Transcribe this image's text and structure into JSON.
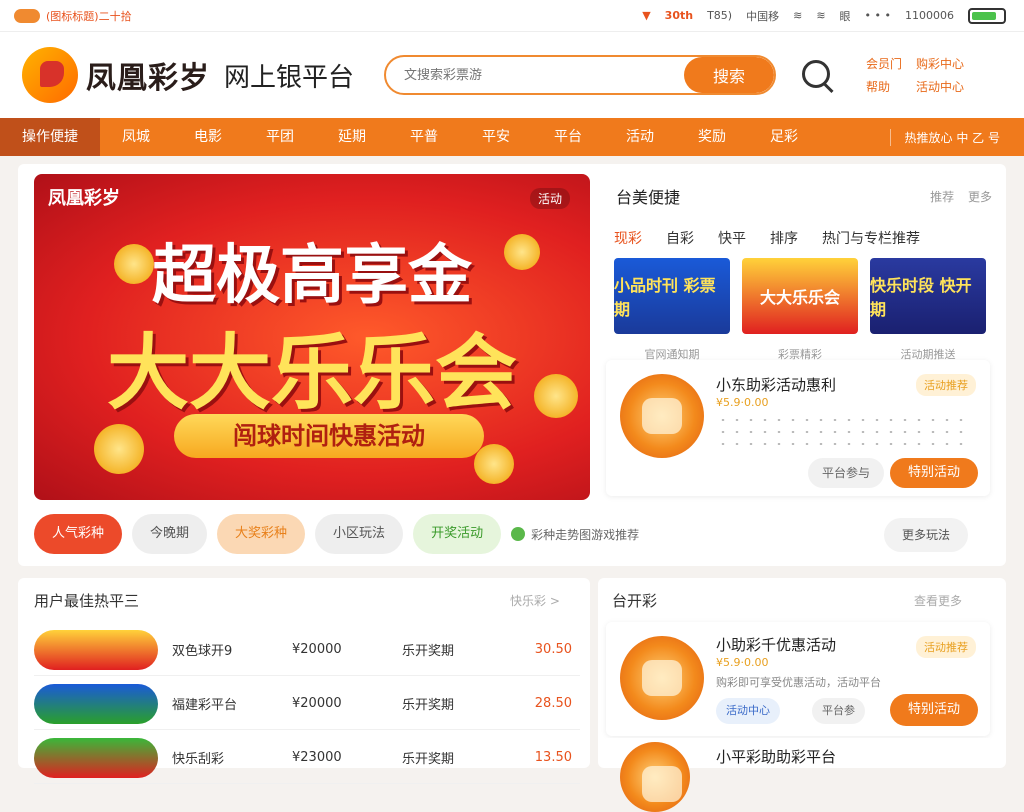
{
  "topstrip": {
    "left_text": "(图标标题)二十拾",
    "signal": "30th",
    "time_label": "T85)",
    "carrier": "中国移",
    "status": "眼",
    "dots": "• • •",
    "battery": "1100006"
  },
  "header": {
    "brand": "凤凰彩岁",
    "platform": "网上银平台",
    "search_placeholder": "文搜索彩票游",
    "search_button": "搜索",
    "links": [
      "会员门",
      "购彩中心",
      "帮助",
      "活动中心"
    ]
  },
  "nav": {
    "items": [
      "操作便捷",
      "凤城",
      "电影",
      "平团",
      "延期",
      "平普",
      "平安",
      "平台",
      "活动",
      "奖励",
      "足彩"
    ],
    "more": "热推放心 中 乙 号"
  },
  "banner": {
    "logo": "凤凰彩岁",
    "tag": "活动",
    "headline1": "超极高享金",
    "headline2": "大大乐乐会",
    "ribbon": "闯球时间快惠活动"
  },
  "right_panel": {
    "title": "台美便捷",
    "links": [
      "推荐",
      "更多"
    ],
    "tabs": [
      "现彩",
      "自彩",
      "快平",
      "排序",
      "热门与专栏推荐"
    ],
    "thumbs": [
      {
        "text": "小品时刊 彩票期"
      },
      {
        "text": "大大乐乐会"
      },
      {
        "text": "快乐时段 快开期"
      }
    ],
    "thumb_captions": [
      "官网通知期",
      "彩票精彩",
      "活动期推送"
    ]
  },
  "promo1": {
    "title": "小东助彩活动惠利",
    "sub": "¥5.9·0.00",
    "tag": "活动推荐",
    "btn_small": "平台参与",
    "btn_main": "特别活动"
  },
  "chips": [
    "人气彩种",
    "今晚期",
    "大奖彩种",
    "小区玩法",
    "开奖活动",
    "彩种走势图游戏推荐",
    "更多玩法"
  ],
  "list": {
    "title": "用户最佳热平三",
    "more": "快乐彩 >",
    "rows": [
      {
        "name": "双色球开9",
        "amount": "¥20000",
        "play": "乐开奖期",
        "price": "30.50"
      },
      {
        "name": "福建彩平台",
        "amount": "¥20000",
        "play": "乐开奖期",
        "price": "28.50"
      },
      {
        "name": "快乐刮彩",
        "amount": "¥23000",
        "play": "乐开奖期",
        "price": "13.50"
      }
    ]
  },
  "promo_section": {
    "title": "台开彩",
    "more": "查看更多",
    "card2": {
      "title": "小助彩千优惠活动",
      "sub": "¥5.9·0.00",
      "desc": "购彩即可享受优惠活动，活动平台",
      "tag": "活动推荐",
      "btn_a": "活动中心",
      "btn_b": "平台参",
      "btn_main": "特别活动"
    },
    "card3": {
      "title": "小平彩助助彩平台"
    }
  },
  "colors": {
    "accent": "#f07a1c",
    "brand_red": "#e8531e",
    "banner_red": "#e02020",
    "gold": "#ffd95a"
  }
}
